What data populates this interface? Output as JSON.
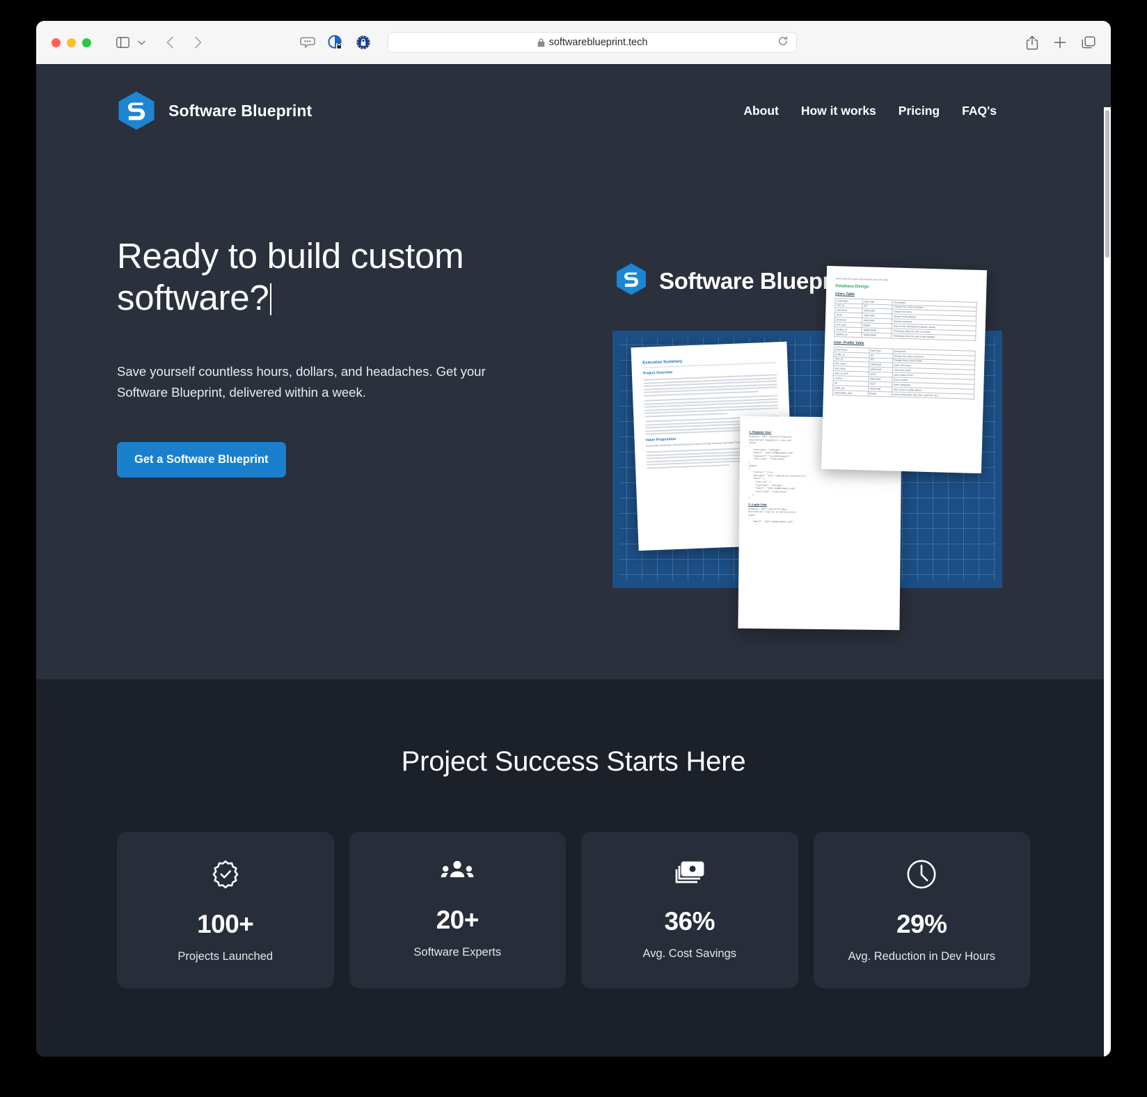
{
  "browser": {
    "url": "softwareblueprint.tech",
    "lock_icon": "lock-icon",
    "reload_icon": "reload-icon",
    "sidebar_icon": "sidebar-toggle-icon",
    "chevron_icon": "chevron-down-icon",
    "back_icon": "back-arrow-icon",
    "forward_icon": "forward-arrow-icon",
    "share_icon": "share-icon",
    "new_tab_icon": "plus-icon",
    "tabs_icon": "tab-overview-icon",
    "extensions": [
      "speech-bubble-extension-icon",
      "privacy-shield-extension-icon",
      "eu-cookie-extension-icon"
    ]
  },
  "site": {
    "brand": "Software Blueprint",
    "logo_icon": "software-blueprint-hexagon-logo",
    "nav": [
      {
        "label": "About"
      },
      {
        "label": "How it works"
      },
      {
        "label": "Pricing"
      },
      {
        "label": "FAQ's"
      }
    ]
  },
  "hero": {
    "title": "Ready to build custom software?",
    "caret_visible": true,
    "subtitle": "Save yourself countless hours, dollars, and headaches. Get your Software Blueprint, delivered within a week.",
    "cta_label": "Get a Software Blueprint",
    "cta_color": "#1a80ce",
    "artwork_brand": "Software Blueprint",
    "documents": {
      "executive": {
        "heading": "Executive Summary",
        "subheading": "Project Overview",
        "value_prop_heading": "Value Proposition",
        "value_prop_text": "Empowering Sustainable Living and Business Practices Through Environmental Impact Tracking"
      },
      "database": {
        "intro": "better meet the project requirements and tech stack.",
        "heading": "Database Design",
        "table1_title": "Users Table",
        "table2_title": "User_Profile Table",
        "columns": [
          "Field Name",
          "Data Type",
          "Description"
        ],
        "users_rows": [
          [
            "user_id",
            "INT",
            "Primary Key, Auto-Increment"
          ],
          [
            "username",
            "VARCHAR",
            "Unique username"
          ],
          [
            "email",
            "VARCHAR",
            "Unique email address"
          ],
          [
            "password",
            "VARCHAR",
            "Hashed password"
          ],
          [
            "user_type",
            "ENUM",
            "Type of user (individual, business, admin)"
          ],
          [
            "created_at",
            "TIMESTAMP",
            "Timestamp when the user is created"
          ],
          [
            "updated_at",
            "TIMESTAMP",
            "Timestamp when the user is last updated"
          ]
        ],
        "profile_rows": [
          [
            "profile_id",
            "INT",
            "Primary Key, Auto-Increment"
          ],
          [
            "user_id",
            "INT",
            "Foreign Key to Users Table"
          ],
          [
            "first_name",
            "VARCHAR",
            "User's first name"
          ],
          [
            "last_name",
            "VARCHAR",
            "User's last name"
          ],
          [
            "date_of_birth",
            "DATE",
            "User's date of birth"
          ],
          [
            "country",
            "VARCHAR",
            "User's country"
          ],
          [
            "bio",
            "TEXT",
            "User's biography"
          ],
          [
            "profile_pic",
            "VARCHAR",
            "URL to user's profile picture"
          ],
          [
            "subscription_type",
            "ENUM",
            "User's subscription type (free, premium, etc.)"
          ]
        ]
      },
      "api": {
        "section1": "1. Register User",
        "section1_endpoint": "Endpoint: POST /api/auth/register",
        "section1_description": "Description: Registers a new user",
        "section1_input": "Input:",
        "section1_output": "Output:",
        "section2": "2. Login User",
        "section2_endpoint": "Endpoint: POST /api/auth/login",
        "section2_description": "Description: Logs in an existing user",
        "section2_input": "Input:"
      }
    }
  },
  "stats": {
    "title": "Project Success Starts Here",
    "cards": [
      {
        "icon": "badge-check-icon",
        "value": "100+",
        "label": "Projects Launched"
      },
      {
        "icon": "users-group-icon",
        "value": "20+",
        "label": "Software Experts"
      },
      {
        "icon": "cash-banknotes-icon",
        "value": "36%",
        "label": "Avg. Cost Savings"
      },
      {
        "icon": "clock-icon",
        "value": "29%",
        "label": "Avg. Reduction in Dev Hours"
      }
    ]
  },
  "theme": {
    "hero_bg": "#2a303c",
    "stats_bg": "#1b2029",
    "card_bg": "#272d39",
    "accent": "#1a80ce",
    "blueprint_blue": "#1c4f86"
  }
}
